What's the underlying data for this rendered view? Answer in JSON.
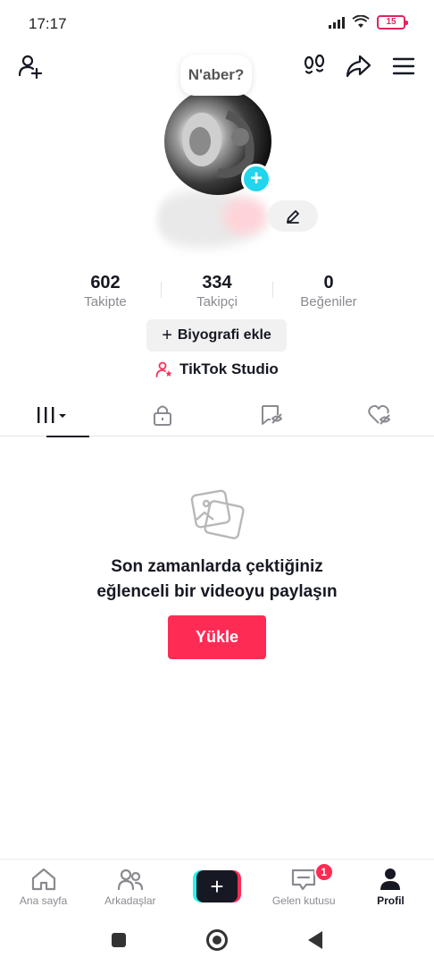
{
  "status_bar": {
    "time": "17:17",
    "battery": "15"
  },
  "profile": {
    "bubble_text": "N'aber?",
    "stats": [
      {
        "value": "602",
        "label": "Takipte"
      },
      {
        "value": "334",
        "label": "Takipçi"
      },
      {
        "value": "0",
        "label": "Beğeniler"
      }
    ],
    "bio_button": "Biyografi ekle",
    "studio_link": "TikTok Studio"
  },
  "tabs": [
    {
      "icon": "grid-icon"
    },
    {
      "icon": "lock-icon"
    },
    {
      "icon": "tagged-icon"
    },
    {
      "icon": "liked-icon"
    }
  ],
  "empty_state": {
    "title_line1": "Son zamanlarda çektiğiniz",
    "title_line2": "eğlenceli bir videoyu paylaşın",
    "upload_button": "Yükle"
  },
  "bottom_nav": {
    "home": "Ana sayfa",
    "friends": "Arkadaşlar",
    "inbox": "Gelen kutusu",
    "inbox_badge": "1",
    "profile": "Profil",
    "create": "+"
  },
  "colors": {
    "accent": "#fe2c55",
    "cyan": "#20d5ec",
    "text": "#161823",
    "muted": "#8a8b91"
  }
}
